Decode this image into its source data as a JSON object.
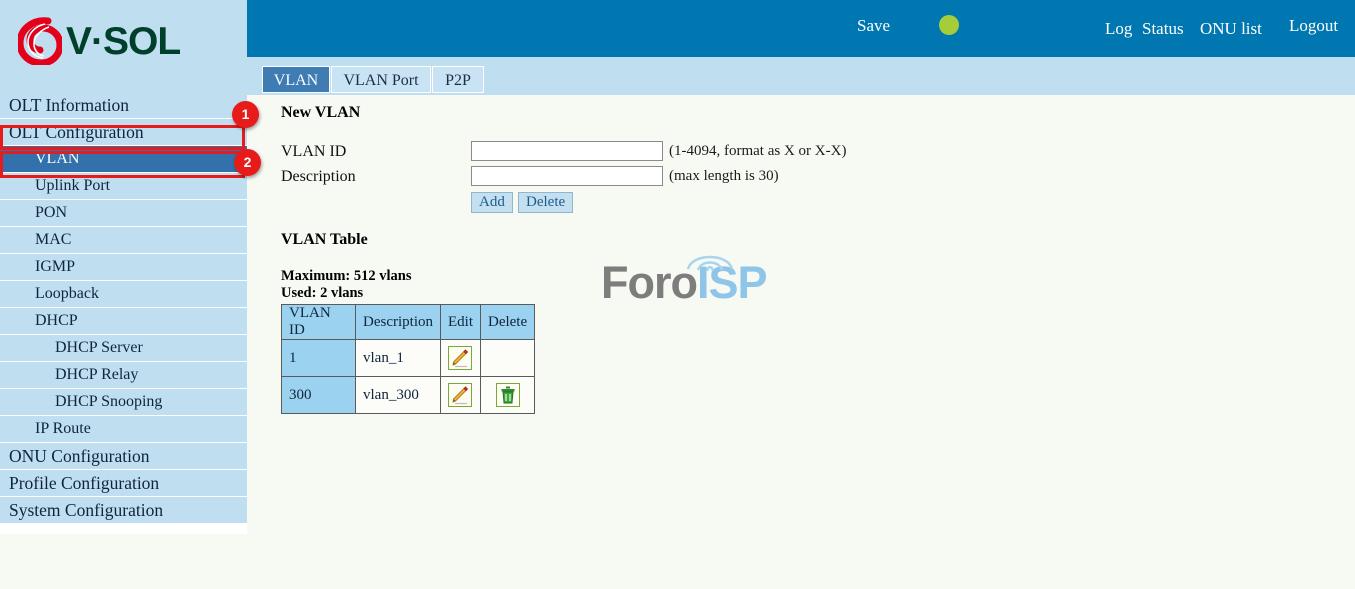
{
  "brand": {
    "logo_text": "V·SOL",
    "logo_mark": "vsol-swirl-logo",
    "logo_red": "#e2001a",
    "logo_green": "#00402a"
  },
  "topbar": {
    "background": "#0077b0",
    "save_label": "Save",
    "status_dot": {
      "name": "status-indicator-dot",
      "color": "#a5cd39"
    },
    "log_label": "Log",
    "status_label": "Status",
    "onu_list_label": "ONU list",
    "logout_label": "Logout"
  },
  "tabs": [
    {
      "label": "VLAN",
      "active": true
    },
    {
      "label": "VLAN Port",
      "active": false
    },
    {
      "label": "P2P",
      "active": false
    }
  ],
  "sidebar": {
    "background": "#bfdff0",
    "selected_color": "#3271ac",
    "items": [
      {
        "label": "OLT Information",
        "level": 0,
        "selected": false
      },
      {
        "label": "OLT Configuration",
        "level": 0,
        "selected": false
      },
      {
        "label": "VLAN",
        "level": 1,
        "selected": true
      },
      {
        "label": "Uplink Port",
        "level": 1,
        "selected": false
      },
      {
        "label": "PON",
        "level": 1,
        "selected": false
      },
      {
        "label": "MAC",
        "level": 1,
        "selected": false
      },
      {
        "label": "IGMP",
        "level": 1,
        "selected": false
      },
      {
        "label": "Loopback",
        "level": 1,
        "selected": false
      },
      {
        "label": "DHCP",
        "level": 1,
        "selected": false
      },
      {
        "label": "DHCP Server",
        "level": 2,
        "selected": false
      },
      {
        "label": "DHCP Relay",
        "level": 2,
        "selected": false
      },
      {
        "label": "DHCP Snooping",
        "level": 2,
        "selected": false
      },
      {
        "label": "IP Route",
        "level": 1,
        "selected": false
      },
      {
        "label": "ONU Configuration",
        "level": 0,
        "selected": false
      },
      {
        "label": "Profile Configuration",
        "level": 0,
        "selected": false
      },
      {
        "label": "System Configuration",
        "level": 0,
        "selected": false
      }
    ]
  },
  "annotations": {
    "color": "#e81b1b",
    "badges": [
      {
        "number": "1",
        "target": "OLT Configuration"
      },
      {
        "number": "2",
        "target": "VLAN"
      }
    ]
  },
  "main": {
    "new_vlan": {
      "title": "New VLAN",
      "vlan_id_label": "VLAN ID",
      "vlan_id_value": "",
      "vlan_id_hint": "(1-4094, format as X or X-X)",
      "description_label": "Description",
      "description_value": "",
      "description_hint": "(max length is 30)",
      "add_label": "Add",
      "delete_label": "Delete"
    },
    "vlan_table": {
      "title": "VLAN Table",
      "maximum_line": "Maximum: 512 vlans",
      "used_line": "Used: 2 vlans",
      "columns": [
        "VLAN ID",
        "Description",
        "Edit",
        "Delete"
      ],
      "rows": [
        {
          "vlan_id": "1",
          "description": "vlan_1",
          "edit_icon": "pencil-edit-icon",
          "delete_icon": ""
        },
        {
          "vlan_id": "300",
          "description": "vlan_300",
          "edit_icon": "pencil-edit-icon",
          "delete_icon": "trash-delete-icon"
        }
      ]
    }
  },
  "watermark": {
    "text_primary": "Foro",
    "text_secondary": "ISP",
    "primary_color": "#7d7d7d",
    "secondary_color": "#8ec5e8",
    "icon": "wifi-antenna-icon"
  }
}
